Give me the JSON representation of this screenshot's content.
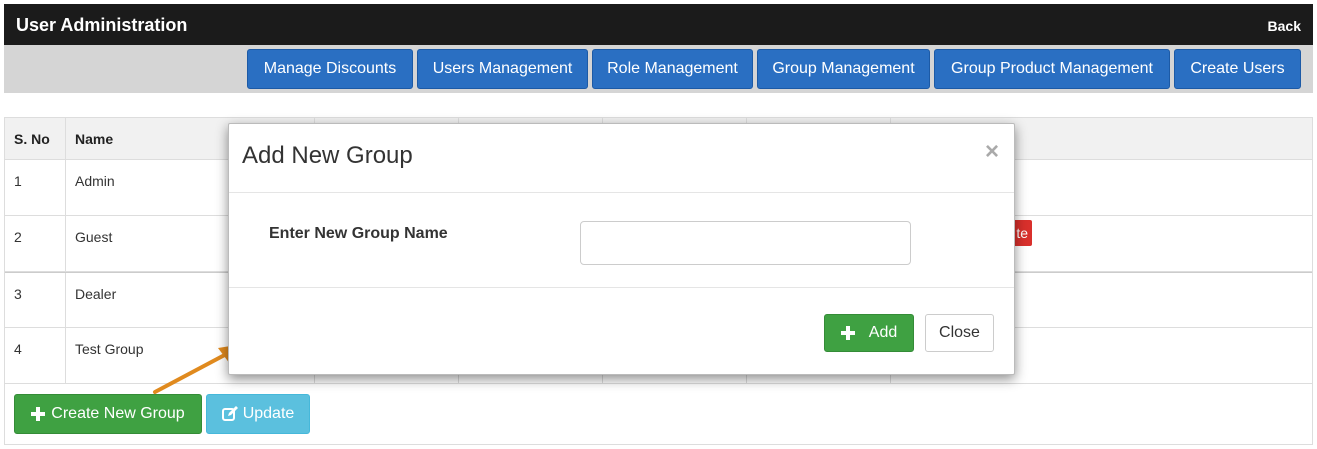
{
  "header": {
    "title": "User Administration",
    "back_label": "Back"
  },
  "nav": {
    "buttons": [
      {
        "label": "Manage Discounts"
      },
      {
        "label": "Users Management"
      },
      {
        "label": "Role Management"
      },
      {
        "label": "Group Management"
      },
      {
        "label": "Group Product Management"
      },
      {
        "label": "Create Users"
      }
    ]
  },
  "table": {
    "headers": [
      "S. No",
      "Name"
    ],
    "rows": [
      {
        "sno": "1",
        "name": "Admin"
      },
      {
        "sno": "2",
        "name": "Guest"
      },
      {
        "sno": "3",
        "name": "Dealer"
      },
      {
        "sno": "4",
        "name": "Test Group"
      }
    ],
    "delete_label_fragment": "te"
  },
  "actions": {
    "create_label": "Create New Group",
    "update_label": "Update"
  },
  "modal": {
    "title": "Add New Group",
    "close_glyph": "×",
    "field_label": "Enter New Group Name",
    "input_value": "",
    "input_placeholder": "",
    "add_label": "Add",
    "close_label": "Close"
  },
  "colors": {
    "header_bg": "#1b1b1b",
    "nav_button": "#2a6fc2",
    "success": "#3fa142",
    "info": "#5bc0de",
    "danger": "#d9302c",
    "arrow": "#e08a1e"
  },
  "icons": {
    "plus": "plus-icon",
    "edit": "edit-icon",
    "close": "close-icon",
    "arrow": "arrow-annotation"
  }
}
